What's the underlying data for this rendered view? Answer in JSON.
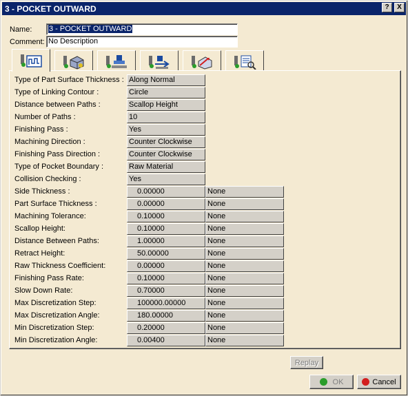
{
  "window": {
    "title": "3 - POCKET OUTWARD",
    "help": "?",
    "close": "X"
  },
  "header": {
    "name_label": "Name:",
    "name_value": "3 - POCKET OUTWARD",
    "comment_label": "Comment:",
    "comment_value": "No Description"
  },
  "tabs": [
    {
      "icon": "strategy-parameters-icon",
      "active": true
    },
    {
      "icon": "geometry-icon"
    },
    {
      "icon": "tool-icon"
    },
    {
      "icon": "feeds-speeds-icon"
    },
    {
      "icon": "macros-icon"
    },
    {
      "icon": "replay-analysis-icon"
    }
  ],
  "params": [
    {
      "label": "Type of Part Surface Thickness :",
      "value": "Along Normal"
    },
    {
      "label": "Type of Linking Contour :",
      "value": "Circle"
    },
    {
      "label": "Distance between Paths :",
      "value": "Scallop Height"
    },
    {
      "label": "Number of Paths :",
      "value": "10"
    },
    {
      "label": "Finishing Pass :",
      "value": "Yes"
    },
    {
      "label": "Machining Direction :",
      "value": "Counter Clockwise"
    },
    {
      "label": "Finishing Pass Direction :",
      "value": "Counter Clockwise"
    },
    {
      "label": "Type of Pocket Boundary :",
      "value": "Raw Material"
    },
    {
      "label": "Collision Checking :",
      "value": "Yes"
    },
    {
      "label": "Side Thickness :",
      "value": "0.00000",
      "extra": "None"
    },
    {
      "label": "Part Surface Thickness :",
      "value": "0.00000",
      "extra": "None"
    },
    {
      "label": "Machining Tolerance:",
      "value": "0.10000",
      "extra": "None"
    },
    {
      "label": "Scallop Height:",
      "value": "0.10000",
      "extra": "None"
    },
    {
      "label": "Distance Between Paths:",
      "value": "1.00000",
      "extra": "None"
    },
    {
      "label": "Retract Height:",
      "value": "50.00000",
      "extra": "None"
    },
    {
      "label": "Raw Thickness Coefficient:",
      "value": "0.00000",
      "extra": "None"
    },
    {
      "label": "Finishing Pass Rate:",
      "value": "0.10000",
      "extra": "None"
    },
    {
      "label": "Slow Down Rate:",
      "value": "0.70000",
      "extra": "None"
    },
    {
      "label": "Max Discretization Step:",
      "value": "100000.00000",
      "extra": "None"
    },
    {
      "label": "Max Discretization Angle:",
      "value": "180.00000",
      "extra": "None"
    },
    {
      "label": "Min Discretization Step:",
      "value": "0.20000",
      "extra": "None"
    },
    {
      "label": "Min Discretization Angle:",
      "value": "0.00400",
      "extra": "None"
    }
  ],
  "buttons": {
    "replay": "Replay",
    "ok": "OK",
    "cancel": "Cancel"
  },
  "colors": {
    "titlebar": "#0a246a",
    "ok_dot": "#2a9d2a",
    "cancel_dot": "#d21e1e",
    "field_bg": "#d4d0c8"
  }
}
